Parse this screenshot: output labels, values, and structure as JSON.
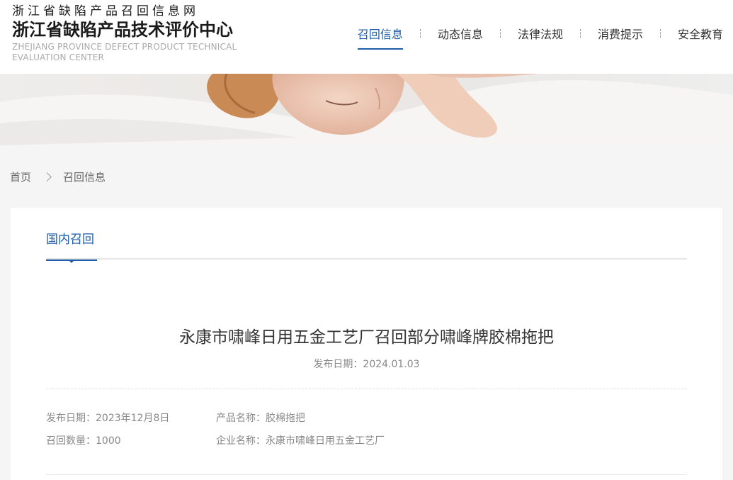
{
  "site": {
    "name_line1": "浙江省缺陷产品召回信息网",
    "name_line2": "浙江省缺陷产品技术评价中心",
    "name_en": "ZHEJIANG PROVINCE DEFECT PRODUCT TECHNICAL EVALUATION CENTER"
  },
  "nav": {
    "items": [
      {
        "label": "召回信息",
        "active": true
      },
      {
        "label": "动态信息",
        "active": false
      },
      {
        "label": "法律法规",
        "active": false
      },
      {
        "label": "消费提示",
        "active": false
      },
      {
        "label": "安全教育",
        "active": false
      }
    ]
  },
  "breadcrumb": {
    "home": "首页",
    "current": "召回信息"
  },
  "tab": {
    "label": "国内召回"
  },
  "article": {
    "title": "永康市啸峰日用五金工艺厂召回部分啸峰牌胶棉拖把",
    "publish_date": "发布日期：2024.01.03",
    "meta": {
      "date": "发布日期：2023年12月8日",
      "product": "产品名称：胶棉拖把",
      "quantity": "召回数量：1000",
      "company": "企业名称：永康市啸峰日用五金工艺厂"
    }
  },
  "colors": {
    "accent": "#1f5da8",
    "background": "#f5f5f5"
  }
}
